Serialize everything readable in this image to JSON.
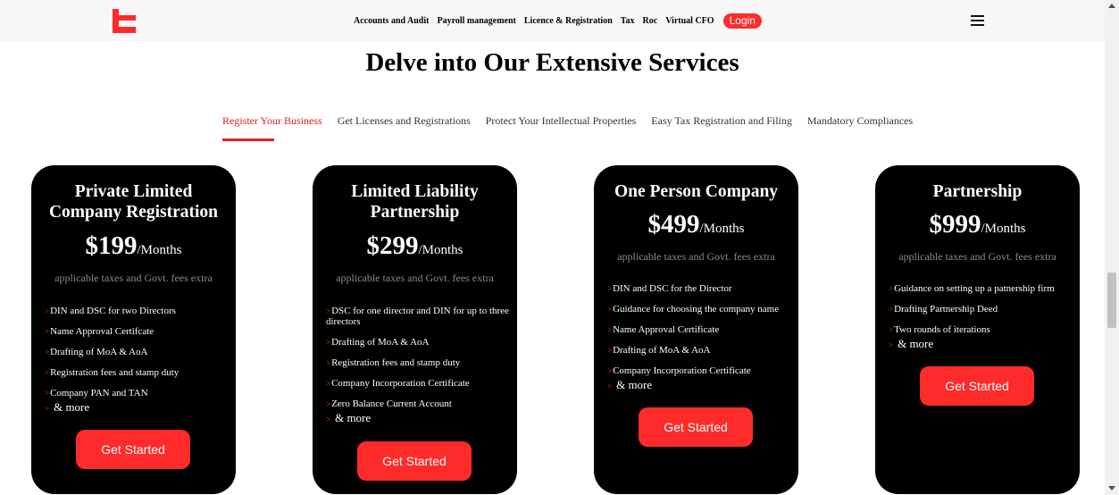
{
  "nav": {
    "links": [
      "Accounts and Audit",
      "Payroll management",
      "Licence & Registration",
      "Tax",
      "Roc",
      "Virtual CFO"
    ],
    "login_label": "Login",
    "brand_color": "#ff2a2a"
  },
  "section": {
    "title": "Delve into Our Extensive Services"
  },
  "tabs": [
    {
      "label": "Register Your Business",
      "active": true
    },
    {
      "label": "Get Licenses and Registrations",
      "active": false
    },
    {
      "label": "Protect Your Intellectual Properties",
      "active": false
    },
    {
      "label": "Easy Tax Registration and Filing",
      "active": false
    },
    {
      "label": "Mandatory Compliances",
      "active": false
    }
  ],
  "cards": [
    {
      "title_lines": [
        "Private Limited",
        "Company Registration"
      ],
      "price": "$199",
      "period": "/Months",
      "note": "applicable taxes and Govt. fees extra",
      "features": [
        "DIN and DSC for two Directors",
        "Name Approval Certifcate",
        "Drafting of MoA & AoA",
        "Registration fees and stamp duty",
        "Company PAN and TAN"
      ],
      "more": "& more",
      "cta": "Get Started"
    },
    {
      "title_lines": [
        "Limited Liability",
        "Partnership"
      ],
      "price": "$299",
      "period": "/Months",
      "note": "applicable taxes and Govt. fees extra",
      "features": [
        "DSC for one director and DIN for up to three directors",
        "Drafting of MoA & AoA",
        "Registration fees and stamp duty",
        "Company Incorporation Certificate",
        "Zero Balance Current Account"
      ],
      "more": "& more",
      "cta": "Get Started"
    },
    {
      "title_lines": [
        "One Person Company"
      ],
      "price": "$499",
      "period": "/Months",
      "note": "applicable taxes and Govt. fees extra",
      "features": [
        "DIN and DSC for the Director",
        "Guidance for choosing the company name",
        "Name Approval Certificate",
        "Drafting of MoA & AoA",
        "Company Incorporation Certificate"
      ],
      "more": "& more",
      "cta": "Get Started"
    },
    {
      "title_lines": [
        "Partnership"
      ],
      "price": "$999",
      "period": "/Months",
      "note": "applicable taxes and Govt. fees extra",
      "features": [
        "Guidance on setting up a patnership firm",
        "Drafting Partnership Deed",
        "Two rounds of iterations"
      ],
      "more": "& more",
      "cta": "Get Started"
    }
  ]
}
